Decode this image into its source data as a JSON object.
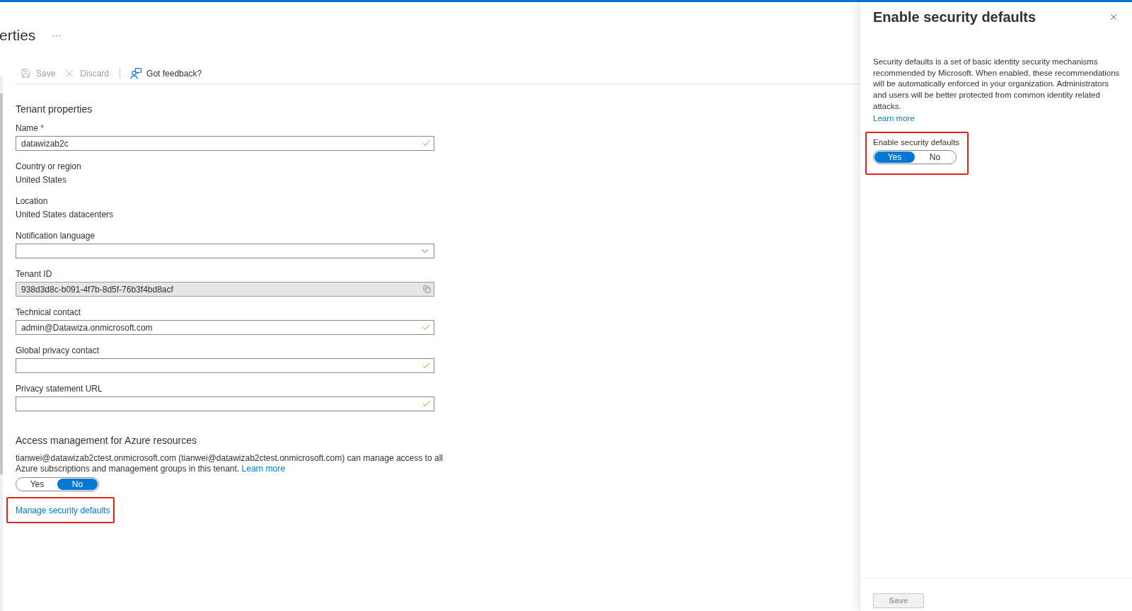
{
  "page": {
    "title": "erties",
    "more": "···"
  },
  "toolbar": [
    {
      "kind": "save",
      "label": "Save",
      "disabled": true
    },
    {
      "kind": "discard",
      "label": "Discard",
      "disabled": true
    },
    {
      "kind": "feedback",
      "label": "Got feedback?",
      "disabled": false
    }
  ],
  "tenant_properties": {
    "heading": "Tenant properties",
    "fields": [
      {
        "kind": "input",
        "label": "Name",
        "required_mark": "*",
        "value": "datawizab2c",
        "valid": true
      },
      {
        "kind": "static",
        "label": "Country or region",
        "value": "United States"
      },
      {
        "kind": "static",
        "label": "Location",
        "value": "United States datacenters"
      },
      {
        "kind": "dropdown",
        "label": "Notification language"
      },
      {
        "kind": "readonly",
        "label": "Tenant ID",
        "value": "938d3d8c-b091-4f7b-8d5f-76b3f4bd8acf"
      },
      {
        "kind": "input",
        "label": "Technical contact",
        "value": "admin@Datawiza.onmicrosoft.com",
        "valid": true
      },
      {
        "kind": "input",
        "label": "Global privacy contact",
        "valid": true
      },
      {
        "kind": "input",
        "label": "Privacy statement URL",
        "valid": true
      }
    ]
  },
  "access_management": {
    "heading": "Access management for Azure resources",
    "text": "tianwei@datawizab2ctest.onmicrosoft.com (tianwei@datawizab2ctest.onmicrosoft.com) can manage access to all Azure subscriptions and management groups in this tenant.",
    "link": "Learn more",
    "toggle": [
      {
        "label": "Yes",
        "selected": false
      },
      {
        "label": "No",
        "selected": true
      }
    ]
  },
  "manage_link": {
    "label": "Manage security defaults",
    "highlighted": true
  },
  "panel": {
    "title": "Enable security defaults",
    "description": "Security defaults is a set of basic identity security mechanisms recommended by Microsoft. When enabled, these recommendations will be automatically enforced in your organization. Administrators and users will be better protected from common identity related attacks.",
    "link": "Learn more",
    "setting": {
      "label": "Enable security defaults",
      "highlighted": true,
      "toggle": [
        {
          "label": "Yes",
          "selected": true
        },
        {
          "label": "No",
          "selected": false
        }
      ]
    },
    "save": {
      "label": "Save",
      "disabled": true
    }
  }
}
